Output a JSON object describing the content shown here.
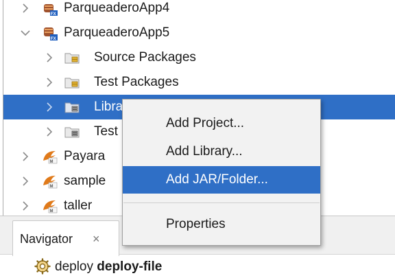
{
  "project_tree": {
    "items": [
      {
        "label": "ParqueaderoApp4",
        "icon": "javafx-project-icon",
        "expanded": false,
        "selected": false
      },
      {
        "label": "ParqueaderoApp5",
        "icon": "javafx-project-icon",
        "expanded": true,
        "selected": false
      },
      {
        "label": "Source Packages",
        "icon": "package-folder-icon",
        "expanded": false,
        "selected": false
      },
      {
        "label": "Test Packages",
        "icon": "package-folder-icon",
        "expanded": false,
        "selected": false
      },
      {
        "label": "Libraries",
        "icon": "library-folder-icon",
        "expanded": false,
        "selected": true
      },
      {
        "label": "Test Libraries",
        "icon": "library-folder-icon",
        "expanded": false,
        "selected": false
      },
      {
        "label": "Payara",
        "icon": "maven-project-icon",
        "expanded": false,
        "selected": false
      },
      {
        "label": "sample",
        "icon": "maven-project-icon",
        "expanded": false,
        "selected": false
      },
      {
        "label": "taller",
        "icon": "maven-project-icon",
        "expanded": false,
        "selected": false
      }
    ]
  },
  "context_menu": {
    "items": [
      {
        "label": "Add Project...",
        "highlighted": false
      },
      {
        "label": "Add Library...",
        "highlighted": false
      },
      {
        "label": "Add JAR/Folder...",
        "highlighted": true
      },
      {
        "label": "Properties",
        "highlighted": false
      }
    ]
  },
  "navigator": {
    "tab_label": "Navigator",
    "close_symbol": "×",
    "item": {
      "prefix": "deploy",
      "name": "deploy-file",
      "icon": "gear-icon"
    }
  },
  "colors": {
    "selection": "#2f6fc6",
    "menu_bg": "#f2f2f2"
  }
}
